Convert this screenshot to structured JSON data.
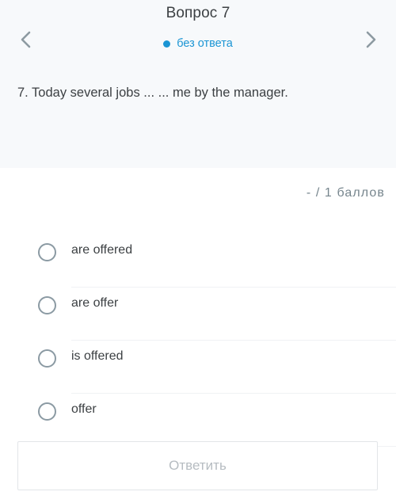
{
  "header": {
    "title": "Вопрос 7",
    "status_label": "без ответа",
    "status_color": "#1b95d4",
    "prev_icon": "chevron-left-icon",
    "next_icon": "chevron-right-icon",
    "question_text": "7. Today several jobs ... ... me by the manager."
  },
  "score": {
    "text": "-  /  1  баллов"
  },
  "options": [
    {
      "label": "are offered",
      "selected": false
    },
    {
      "label": "are offer",
      "selected": false
    },
    {
      "label": "is offered",
      "selected": false
    },
    {
      "label": "offer",
      "selected": false
    }
  ],
  "submit": {
    "label": "Ответить",
    "enabled": false
  }
}
